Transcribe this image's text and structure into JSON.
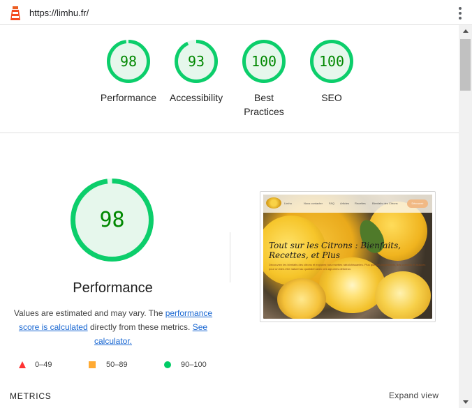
{
  "header": {
    "url": "https://limhu.fr/",
    "logo_icon": "lighthouse-icon",
    "menu_icon": "more-vert-icon"
  },
  "gauges": [
    {
      "score": "98",
      "label": "Performance",
      "value": 0.98
    },
    {
      "score": "93",
      "label": "Accessibility",
      "value": 0.93
    },
    {
      "score": "100",
      "label": "Best Practices",
      "value": 1.0
    },
    {
      "score": "100",
      "label": "SEO",
      "value": 1.0
    }
  ],
  "performance": {
    "score": "98",
    "value": 0.98,
    "title": "Performance",
    "desc_text1": "Values are estimated and may vary. The ",
    "desc_link1": "performance score is calculated",
    "desc_text2": " directly from these metrics. ",
    "desc_link2": "See calculator."
  },
  "screenshot": {
    "brand": "Limhu",
    "nav": [
      "Nous contacter",
      "FAQ",
      "Articles",
      "Recettes",
      "Bienfaits des Citrons"
    ],
    "cta": "Découvrir",
    "heading": "Tout sur les Citrons : Bienfaits, Recettes, et Plus",
    "sub": "Découvrez les bienfaits des citrons et explorez nos recettes rafraîchissantes. Plus que des ingrédients, des conseils et astuces pour un bien-être naturel au quotidien avec ces agrumes délicieux."
  },
  "legend": [
    {
      "range": "0–49",
      "icon": "fail-triangle-icon",
      "color": "#ff3333"
    },
    {
      "range": "50–89",
      "icon": "average-square-icon",
      "color": "#ffaa33"
    },
    {
      "range": "90–100",
      "icon": "pass-circle-icon",
      "color": "#00cc66"
    }
  ],
  "metrics": {
    "title": "METRICS",
    "expand": "Expand view"
  },
  "colors": {
    "pass": "#0cce6b",
    "pass_fill": "#e6f7ec",
    "pass_text": "#008800",
    "link": "#1967d2"
  }
}
